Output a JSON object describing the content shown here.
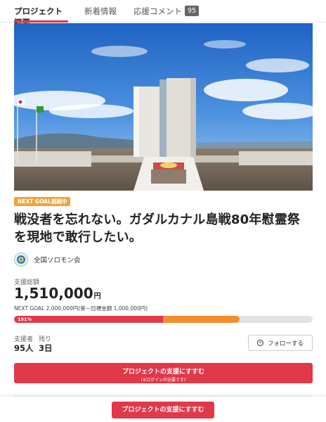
{
  "tabs": [
    {
      "label": "プロジェクト概要"
    },
    {
      "label": "新着情報"
    },
    {
      "label": "応援コメント",
      "count": "95"
    }
  ],
  "tag": "NEXT GOAL挑戦中",
  "title": "戦没者を忘れない。ガダルカナル島戦80年慰霊祭を現地で敢行したい。",
  "organizer": "全国ソロモン会",
  "funding": {
    "label": "支援総額",
    "amount": "1,510,000",
    "currency": "円",
    "goal_text": "NEXT GOAL 2,000,000円(第一目標金額 1,000,000円)",
    "percent_label": "151%",
    "progress_first_goal_pct": 151,
    "progress_next_goal_fraction": 0.755
  },
  "stats": {
    "supporters_label": "支援者",
    "supporters_value": "95人",
    "remaining_label": "残り",
    "remaining_value": "3日"
  },
  "follow_label": "フォローする",
  "support_button": {
    "label": "プロジェクトの支援にすすむ",
    "note": "(※ログインが必要です)"
  },
  "footer_button": "プロジェクトの支援にすすむ",
  "colors": {
    "accent": "#e0394a",
    "progress_secondary": "#f38e2a",
    "tag": "#f0a53a"
  }
}
